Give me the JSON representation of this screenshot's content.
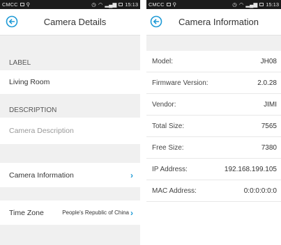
{
  "left": {
    "status": {
      "carrier": "CMCC",
      "time": "15:13"
    },
    "title": "Camera Details",
    "label_section": "LABEL",
    "label_value": "Living Room",
    "description_section": "DESCRIPTION",
    "description_placeholder": "Camera Description",
    "camera_info_label": "Camera Information",
    "time_zone_label": "Time Zone",
    "time_zone_value": "People's Republic of China"
  },
  "right": {
    "status": {
      "carrier": "CMCC",
      "time": "15:13"
    },
    "title": "Camera Information",
    "rows": [
      {
        "key": "Model:",
        "value": "JH08"
      },
      {
        "key": "Firmware Version:",
        "value": "2.0.28"
      },
      {
        "key": "Vendor:",
        "value": "JIMI"
      },
      {
        "key": "Total Size:",
        "value": "7565"
      },
      {
        "key": "Free Size:",
        "value": "7380"
      },
      {
        "key": "IP Address:",
        "value": "192.168.199.105"
      },
      {
        "key": "MAC Address:",
        "value": "0:0:0:0:0:0"
      }
    ]
  },
  "colors": {
    "accent": "#1e9ad6",
    "page_bg": "#f0f0f0",
    "statusbar": "#1b1b1b"
  },
  "icons": {
    "back": "back-circle-arrow-icon",
    "chevron": "chevron-right-icon"
  }
}
